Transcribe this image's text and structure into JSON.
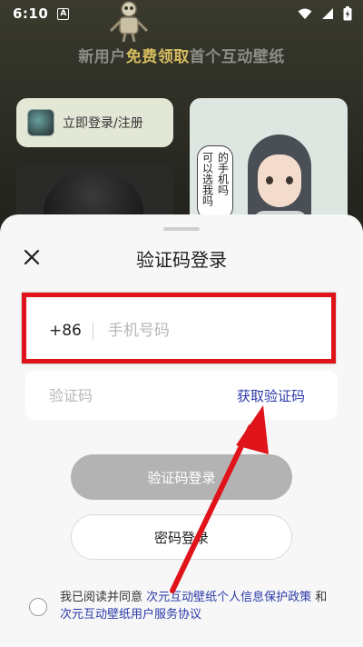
{
  "status_bar": {
    "time": "6:10",
    "notification_glyph": "A",
    "icons": [
      "wifi-icon",
      "signal-icon",
      "battery-charging-icon"
    ]
  },
  "background": {
    "banner_prefix": "新用户",
    "banner_highlight": "免费领取",
    "banner_suffix": "首个互动壁纸",
    "login_card_label": "立即登录/注册",
    "speech_bubble_columns": [
      "可以选我吗",
      "的手机吗"
    ],
    "colors": {
      "banner_highlight": "#d4bb5f",
      "login_card_bg": "#e3e7d6"
    }
  },
  "sheet": {
    "title": "验证码登录",
    "close_icon": "close-icon",
    "phone": {
      "country_code": "+86",
      "placeholder": "手机号码",
      "value": ""
    },
    "code": {
      "placeholder": "验证码",
      "value": "",
      "get_code_label": "获取验证码"
    },
    "primary_button": "验证码登录",
    "secondary_button": "密码登录",
    "agreement": {
      "prefix": "我已阅读并同意 ",
      "privacy_link": "次元互动壁纸个人信息保护政策",
      "connector": " 和 ",
      "terms_link": "次元互动壁纸用户服务协议",
      "checked": false
    },
    "colors": {
      "link": "#2a39a8",
      "primary_button_bg": "#b3b3b3",
      "highlight_border": "#e0121a",
      "arrow": "#e0121a"
    }
  }
}
